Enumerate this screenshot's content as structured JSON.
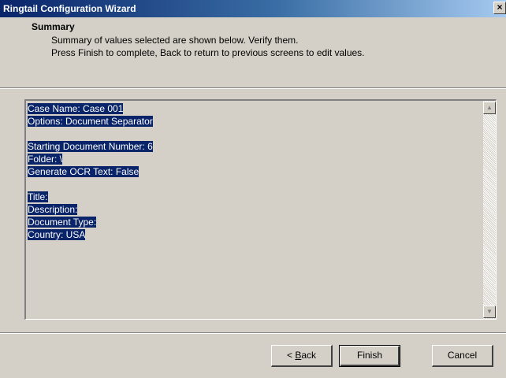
{
  "window": {
    "title": "Ringtail Configuration Wizard",
    "close_label": "×"
  },
  "header": {
    "title": "Summary",
    "line1": "Summary of values selected are shown below. Verify them.",
    "line2": "Press Finish to complete, Back to return to previous screens to edit values."
  },
  "summary": {
    "lines": [
      "Case Name: Case 001",
      "Options: Document Separator",
      "",
      "Starting Document Number: 6",
      "Folder: \\",
      "Generate OCR Text: False",
      "",
      "Title:",
      "Description:",
      "Document Type:",
      "Country: USA"
    ]
  },
  "scrollbar": {
    "up_icon": "scroll-up-arrow",
    "down_icon": "scroll-down-arrow"
  },
  "buttons": {
    "back_prefix": "< ",
    "back_mnemonic": "B",
    "back_rest": "ack",
    "finish": "Finish",
    "cancel": "Cancel"
  }
}
